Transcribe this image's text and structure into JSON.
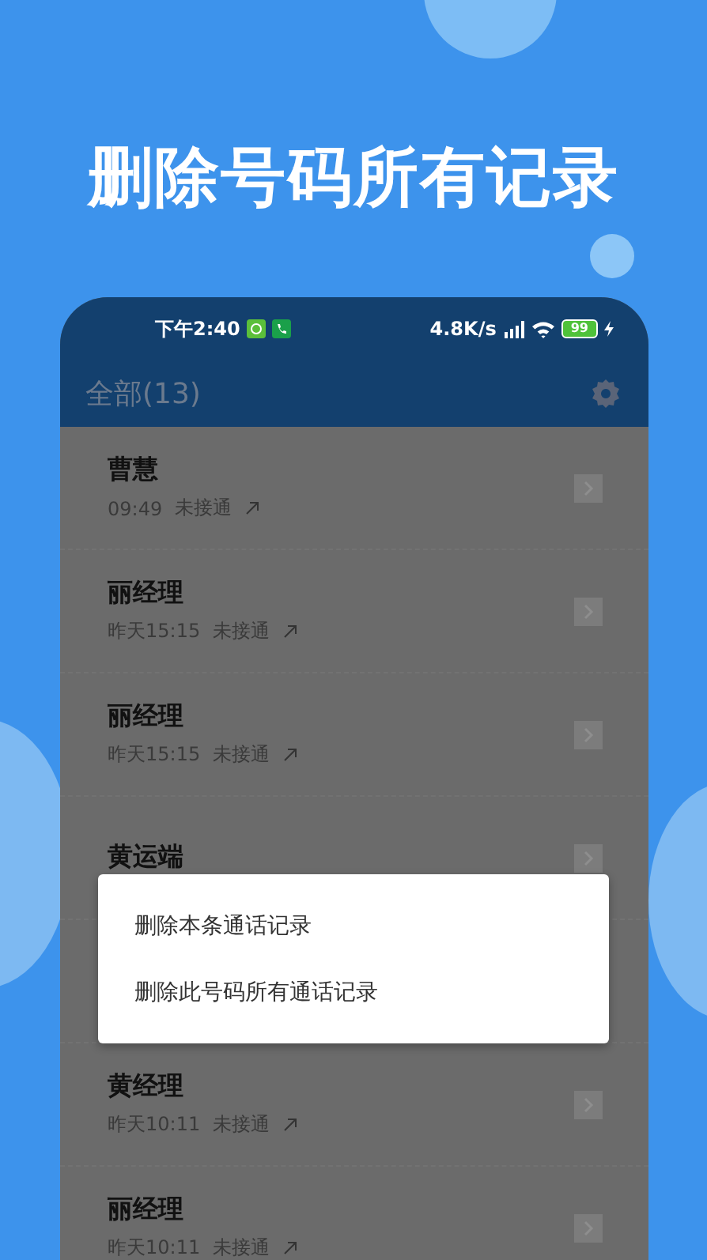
{
  "headline": "删除号码所有记录",
  "status_bar": {
    "time": "下午2:40",
    "speed": "4.8K/s",
    "battery": "99"
  },
  "header": {
    "title": "全部(13)"
  },
  "calls": [
    {
      "name": "曹慧",
      "time": "09:49",
      "status": "未接通"
    },
    {
      "name": "丽经理",
      "time": "昨天15:15",
      "status": "未接通"
    },
    {
      "name": "丽经理",
      "time": "昨天15:15",
      "status": "未接通"
    },
    {
      "name": "黄运端"
    },
    {
      "name": "黄经理",
      "time": "昨天10:11",
      "status": "未接通"
    },
    {
      "name": "丽经理",
      "time": "昨天10:11",
      "status": "未接通"
    }
  ],
  "menu": {
    "items": [
      "删除本条通话记录",
      "删除此号码所有通话记录"
    ]
  }
}
